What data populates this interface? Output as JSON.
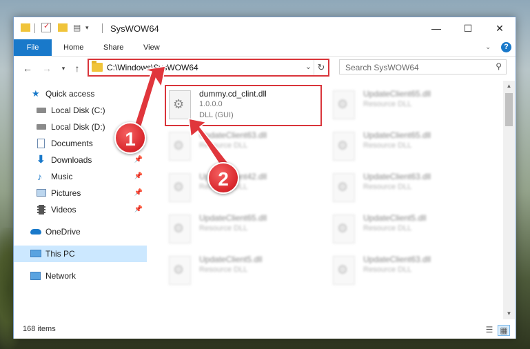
{
  "window": {
    "title": "SysWOW64",
    "controls": {
      "minimize": "—",
      "maximize": "☐",
      "close": "✕"
    }
  },
  "ribbon": {
    "tabs": [
      {
        "label": "File"
      },
      {
        "label": "Home"
      },
      {
        "label": "Share"
      },
      {
        "label": "View"
      }
    ],
    "help": "?"
  },
  "navigation": {
    "path": "C:\\Windows\\SysWOW64",
    "search_placeholder": "Search SysWOW64"
  },
  "sidebar": {
    "items": [
      {
        "label": "Quick access",
        "icon": "star-icon",
        "pinned": false
      },
      {
        "label": "Local Disk (C:)",
        "icon": "drive-icon",
        "pinned": true
      },
      {
        "label": "Local Disk (D:)",
        "icon": "drive-icon",
        "pinned": true
      },
      {
        "label": "Documents",
        "icon": "documents-icon",
        "pinned": true
      },
      {
        "label": "Downloads",
        "icon": "downloads-icon",
        "pinned": true
      },
      {
        "label": "Music",
        "icon": "music-icon",
        "pinned": true
      },
      {
        "label": "Pictures",
        "icon": "pictures-icon",
        "pinned": true
      },
      {
        "label": "Videos",
        "icon": "videos-icon",
        "pinned": true
      },
      {
        "label": "OneDrive",
        "icon": "cloud-icon",
        "pinned": false
      },
      {
        "label": "This PC",
        "icon": "computer-icon",
        "pinned": false,
        "selected": true
      },
      {
        "label": "Network",
        "icon": "network-icon",
        "pinned": false
      }
    ]
  },
  "files": {
    "highlighted": {
      "name": "dummy.cd_clint.dll",
      "version": "1.0.0.0",
      "type": "DLL (GUI)"
    },
    "others": [
      {
        "name": "UpdateClient65.dll",
        "type": "Resource DLL"
      },
      {
        "name": "UpdateClient65.dll",
        "type": "Resource DLL"
      },
      {
        "name": "UpdateClient63.dll",
        "type": "Resource DLL"
      },
      {
        "name": "UpdateClient42.dll",
        "type": "Resource DLL"
      },
      {
        "name": "UpdateClient63.dll",
        "type": "Resource DLL"
      },
      {
        "name": "UpdateClient65.dll",
        "type": "Resource DLL"
      },
      {
        "name": "UpdateClient5.dll",
        "type": "Resource DLL"
      },
      {
        "name": "UpdateClient5.dll",
        "type": "Resource DLL"
      },
      {
        "name": "UpdateClient63.dll",
        "type": "Resource DLL"
      }
    ]
  },
  "status": {
    "count": "168 items"
  },
  "callouts": [
    "1",
    "2"
  ],
  "colors": {
    "accent": "#1979ca",
    "highlight": "#d9343a",
    "selected": "#cce8ff"
  }
}
